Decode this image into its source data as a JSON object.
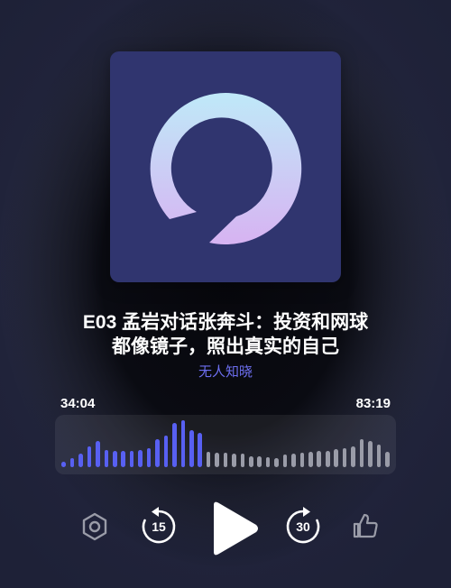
{
  "episode": {
    "title_line1": "E03 孟岩对话张奔斗：投资和网球",
    "title_line2": "都像镜子，照出真实的自己",
    "podcast_name": "无人知晓"
  },
  "player": {
    "elapsed": "34:04",
    "remaining": "83:19",
    "progress_fraction": 0.29,
    "skip_back_seconds": "15",
    "skip_forward_seconds": "30",
    "waveform_played": [
      6,
      10,
      14,
      22,
      28,
      18,
      17,
      17,
      17,
      18,
      20,
      30,
      34,
      47,
      50,
      39,
      37
    ],
    "waveform_unplayed": [
      16,
      15,
      15,
      14,
      14,
      12,
      12,
      11,
      10,
      13,
      14,
      15,
      16,
      17,
      17,
      19,
      20,
      22,
      30,
      28,
      24,
      16
    ],
    "colors": {
      "accent": "#5763f0",
      "played_bar": "#5860f2",
      "unplayed_bar": "#9a9ca8"
    }
  },
  "icons": {
    "settings": "hexagon-settings-icon",
    "skip_back": "rewind-15-icon",
    "play": "play-icon",
    "skip_forward": "forward-30-icon",
    "like": "thumbs-up-icon"
  }
}
